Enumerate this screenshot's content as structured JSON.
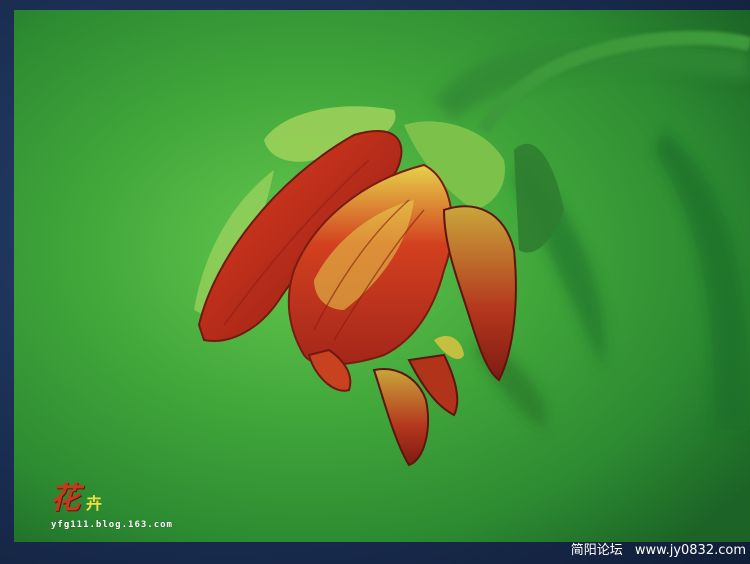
{
  "image": {
    "subject": "flower-bud",
    "colors": {
      "frame": "#1d3358",
      "background_green": "#3fa43a",
      "petal_red": "#b4231a",
      "petal_yellow": "#e3c93a"
    }
  },
  "watermark": {
    "glyph_main": "花",
    "glyph_secondary": "卉",
    "url": "yfg111.blog.163.com"
  },
  "footer": {
    "site_name": "简阳论坛",
    "site_url": "www.jy0832.com"
  }
}
